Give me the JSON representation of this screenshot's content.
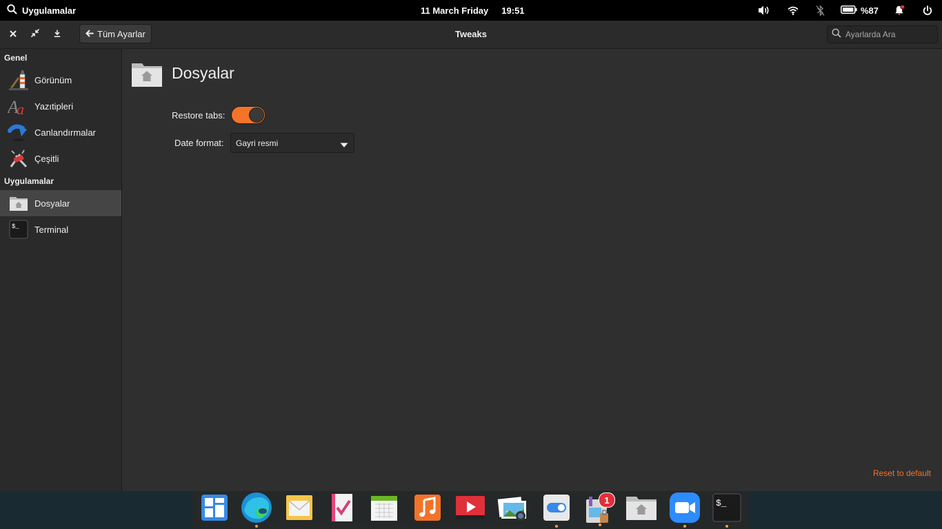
{
  "panel": {
    "apps_label": "Uygulamalar",
    "date": "11 March Friday",
    "time": "19:51",
    "battery": "%87"
  },
  "window": {
    "title": "Tweaks",
    "back_label": "Tüm Ayarlar",
    "search_placeholder": "Ayarlarda Ara"
  },
  "sidebar": {
    "section_general": "Genel",
    "section_apps": "Uygulamalar",
    "items": [
      {
        "label": "Görünüm",
        "icon": "appearance-icon"
      },
      {
        "label": "Yazıtipleri",
        "icon": "fonts-icon"
      },
      {
        "label": "Canlandırmalar",
        "icon": "animations-icon"
      },
      {
        "label": "Çeşitli",
        "icon": "misc-icon"
      },
      {
        "label": "Dosyalar",
        "icon": "files-icon"
      },
      {
        "label": "Terminal",
        "icon": "terminal-icon"
      }
    ]
  },
  "main": {
    "title": "Dosyalar",
    "restore_tabs_label": "Restore tabs:",
    "restore_tabs_on": true,
    "date_format_label": "Date format:",
    "date_format_value": "Gayri resmi",
    "reset_label": "Reset to default"
  },
  "dock": {
    "items": [
      "multitasking-view-icon",
      "edge-browser-icon",
      "mail-icon",
      "tasks-icon",
      "calendar-icon",
      "music-icon",
      "videos-icon",
      "photos-icon",
      "settings-icon",
      "appcenter-icon",
      "files-icon",
      "zoom-icon",
      "terminal-icon"
    ],
    "appcenter_badge": "1"
  },
  "colors": {
    "accent": "#f37329",
    "window_bg": "#2f2f2f",
    "sidebar_bg": "#2a2a2a",
    "panel_bg": "#000000"
  }
}
